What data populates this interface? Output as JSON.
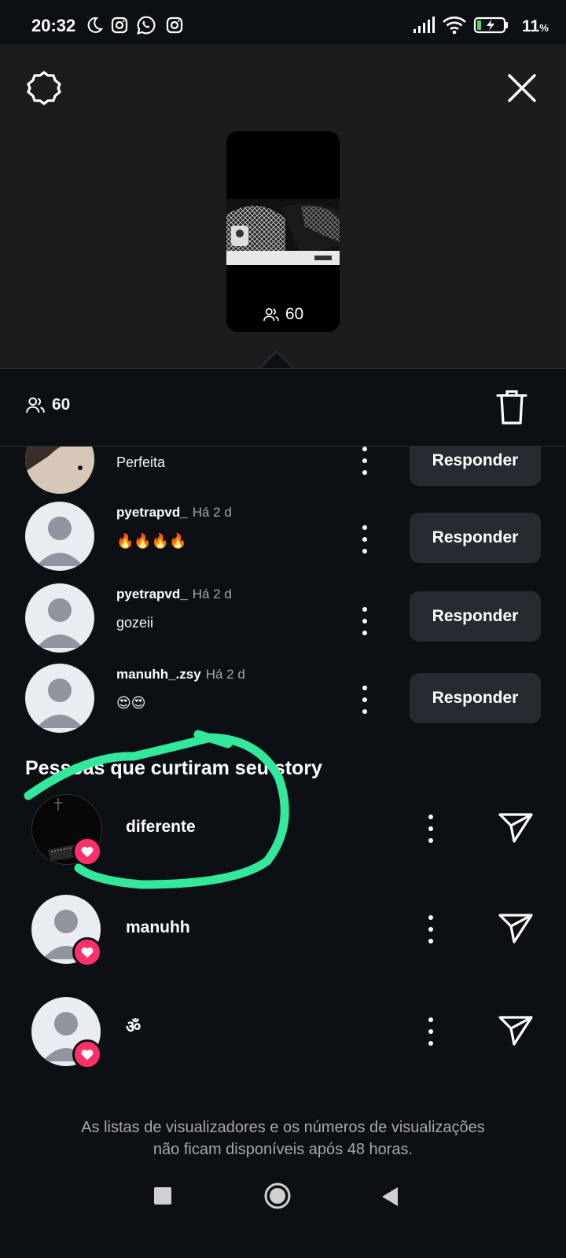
{
  "status_bar": {
    "time": "20:32",
    "battery_percent": "11",
    "battery_unit": "%",
    "icons": [
      "moon-icon",
      "instagram-icon",
      "whatsapp-icon",
      "instagram-icon",
      "signal-icon",
      "wifi-icon",
      "battery-charging-icon"
    ]
  },
  "header": {
    "settings_icon": "gear-icon",
    "close_icon": "close-icon"
  },
  "story_preview": {
    "viewer_count": "60"
  },
  "viewer_bar": {
    "viewer_count": "60",
    "delete_icon": "trash-icon"
  },
  "replies": [
    {
      "username": "",
      "time": "",
      "message": "Perfeita",
      "button": "Responder"
    },
    {
      "username": "pyetrapvd_",
      "time": "Há 2 d",
      "message": "🔥🔥🔥🔥",
      "button": "Responder"
    },
    {
      "username": "pyetrapvd_",
      "time": "Há 2 d",
      "message": "gozeii",
      "button": "Responder"
    },
    {
      "username": "manuhh_.zsy",
      "time": "Há 2 d",
      "message": "😍😍",
      "button": "Responder"
    }
  ],
  "likes_section": {
    "heading": "Pessoas que curtiram seu story",
    "people": [
      {
        "name": "diferente"
      },
      {
        "name": "manuhh"
      },
      {
        "name": "ॐ"
      }
    ]
  },
  "footer": {
    "line1": "As listas de visualizadores e os números de visualizações",
    "line2": "não ficam disponíveis após 48 horas."
  },
  "colors": {
    "background": "#0c1014",
    "panel": "#1c1c1c",
    "button": "#262b31",
    "heart": "#ff3069",
    "annotation": "#33e89a"
  }
}
